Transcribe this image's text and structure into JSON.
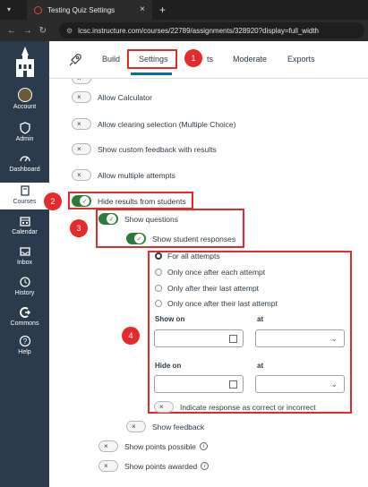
{
  "browser": {
    "tab_title": "Testing Quiz Settings",
    "url": "lcsc.instructure.com/courses/22789/assignments/328920?display=full_width"
  },
  "sidebar": {
    "items": [
      {
        "label": "Account"
      },
      {
        "label": "Admin"
      },
      {
        "label": "Dashboard"
      },
      {
        "label": "Courses"
      },
      {
        "label": "Calendar"
      },
      {
        "label": "Inbox"
      },
      {
        "label": "History"
      },
      {
        "label": "Commons"
      },
      {
        "label": "Help"
      }
    ]
  },
  "topnav": {
    "build": "Build",
    "settings": "Settings",
    "results": "ts",
    "moderate": "Moderate",
    "exports": "Exports"
  },
  "settings_list": {
    "allow_calculator": "Allow Calculator",
    "allow_clearing": "Allow clearing selection (Multiple Choice)",
    "show_custom_feedback": "Show custom feedback with results",
    "allow_multiple": "Allow multiple attempts",
    "hide_results": "Hide results from students",
    "show_questions": "Show questions",
    "show_student_responses": "Show student responses",
    "radio_options": [
      "For all attempts",
      "Only once after each attempt",
      "Only after their last attempt",
      "Only once after their last attempt"
    ],
    "show_on": "Show on",
    "hide_on": "Hide on",
    "at": "at",
    "indicate_response": "Indicate response as correct or incorrect",
    "show_feedback": "Show feedback",
    "show_points_possible": "Show points possible",
    "show_points_awarded": "Show points awarded"
  },
  "badges": [
    "1",
    "2",
    "3",
    "4"
  ],
  "colors": {
    "accent_red": "#e52a2a",
    "toggle_on": "#2b7b3d",
    "sidebar": "#2a3b4d"
  }
}
